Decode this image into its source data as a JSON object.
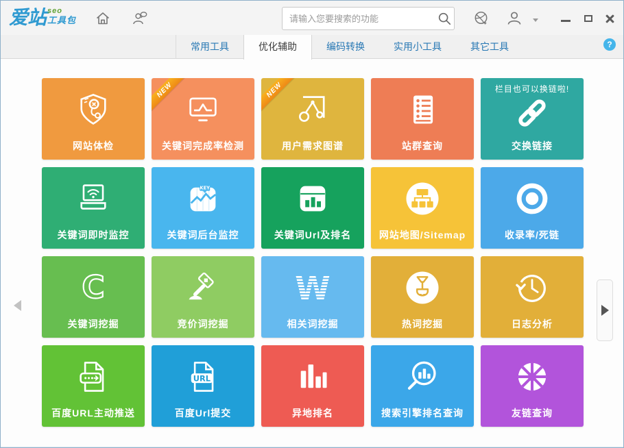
{
  "logo": {
    "main": "爱站",
    "seo": "seo",
    "sub": "工具包"
  },
  "topbar": {
    "search_placeholder": "请输入您要搜索的功能",
    "icons": [
      "home-icon",
      "feedback-icon",
      "search-icon",
      "website-icon",
      "user-icon",
      "caret-down-icon",
      "minimize-icon",
      "maximize-icon",
      "close-icon"
    ]
  },
  "tabs": [
    {
      "name": "tab-common-tools",
      "label": "常用工具",
      "active": false
    },
    {
      "name": "tab-optimize-assist",
      "label": "优化辅助",
      "active": true
    },
    {
      "name": "tab-encode-convert",
      "label": "编码转换",
      "active": false
    },
    {
      "name": "tab-small-tools",
      "label": "实用小工具",
      "active": false
    },
    {
      "name": "tab-other-tools",
      "label": "其它工具",
      "active": false
    }
  ],
  "help": {
    "label": "?"
  },
  "icon_texts": {
    "chart-key": "KEY",
    "document-url": "URL",
    "letter-c": "C",
    "letter-w": "W"
  },
  "grid": {
    "tiles": [
      {
        "name": "tile-site-checkup",
        "label": "网站体检",
        "color": "#F09A3F",
        "icon": "shield-stethoscope-icon"
      },
      {
        "name": "tile-keyword-completion",
        "label": "关键词完成率检测",
        "color": "#F5905E",
        "icon": "monitor-chart-icon",
        "badge": "NEW"
      },
      {
        "name": "tile-user-demand-map",
        "label": "用户需求图谱",
        "color": "#DFB53E",
        "icon": "node-graph-icon",
        "badge": "NEW"
      },
      {
        "name": "tile-site-group-query",
        "label": "站群查询",
        "color": "#EE7D55",
        "icon": "list-notebook-icon"
      },
      {
        "name": "tile-exchange-links",
        "label": "交换链接",
        "color": "#2FA8A1",
        "icon": "chain-link-icon",
        "note": "栏目也可以换链啦!"
      },
      {
        "name": "tile-keyword-live-monitor",
        "label": "关键词即时监控",
        "color": "#2FAE74",
        "icon": "laptop-wifi-icon"
      },
      {
        "name": "tile-keyword-bg-monitor",
        "label": "关键词后台监控",
        "color": "#49B6EE",
        "icon": "chart-key-icon"
      },
      {
        "name": "tile-keyword-url-rank",
        "label": "关键词Url及排名",
        "color": "#16A25D",
        "icon": "bar-card-icon"
      },
      {
        "name": "tile-sitemap",
        "label": "网站地图/Sitemap",
        "color": "#F6C338",
        "icon": "sitemap-icon"
      },
      {
        "name": "tile-index-rate-deadlink",
        "label": "收录率/死链",
        "color": "#4CA9E9",
        "icon": "record-circle-icon"
      },
      {
        "name": "tile-keyword-mining",
        "label": "关键词挖掘",
        "color": "#67BE50",
        "icon": "letter-c-icon"
      },
      {
        "name": "tile-bidword-mining",
        "label": "竞价词挖掘",
        "color": "#8FCC62",
        "icon": "gavel-icon"
      },
      {
        "name": "tile-related-word-mining",
        "label": "相关词挖掘",
        "color": "#66BAEF",
        "icon": "letter-w-icon"
      },
      {
        "name": "tile-hotword-mining",
        "label": "热词挖掘",
        "color": "#E2AF39",
        "icon": "shovel-icon"
      },
      {
        "name": "tile-log-analysis",
        "label": "日志分析",
        "color": "#E2AF39",
        "icon": "history-clock-icon"
      },
      {
        "name": "tile-baidu-url-push",
        "label": "百度URL主动推送",
        "color": "#62C236",
        "icon": "document-push-icon"
      },
      {
        "name": "tile-baidu-url-submit",
        "label": "百度Url提交",
        "color": "#209FD8",
        "icon": "document-url-icon"
      },
      {
        "name": "tile-remote-ranking",
        "label": "异地排名",
        "color": "#EE5B53",
        "icon": "bars-icon"
      },
      {
        "name": "tile-se-rank-query",
        "label": "搜索引擎排名查询",
        "color": "#3BA7E9",
        "icon": "search-chart-icon"
      },
      {
        "name": "tile-friend-link-query",
        "label": "友链查询",
        "color": "#B254DB",
        "icon": "wheel-icon"
      }
    ]
  },
  "nav": {
    "left_icon": "scroll-left-arrow",
    "right_icon": "scroll-right-arrow"
  }
}
